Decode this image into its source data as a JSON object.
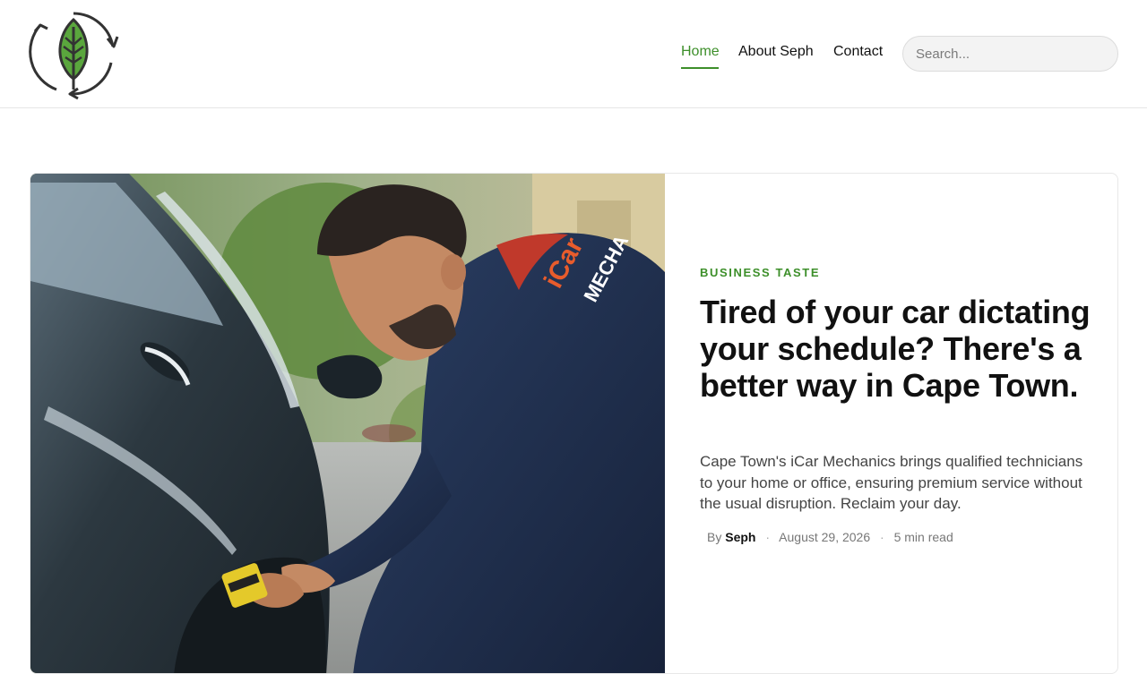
{
  "header": {
    "logo_icon": "leaf-recycle-logo-icon",
    "nav": [
      {
        "label": "Home",
        "active": true
      },
      {
        "label": "About Seph",
        "active": false
      },
      {
        "label": "Contact",
        "active": false
      }
    ],
    "search": {
      "placeholder": "Search...",
      "value": ""
    }
  },
  "featured_post": {
    "image_icon": "mechanic-hero-image",
    "category": "BUSINESS TASTE",
    "title": "Tired of your car dictating your schedule? There's a better way in Cape Town.",
    "excerpt": "Cape Town's iCar Mechanics brings qualified technicians to your home or office, ensuring premium service without the usual disruption. Reclaim your day.",
    "meta": {
      "by_label": "By",
      "author": "Seph",
      "date": "August 29, 2026",
      "read_time": "5 min read"
    },
    "shirt_text_1": "iCar",
    "shirt_text_2": "MECHA"
  },
  "colors": {
    "accent": "#3d8f2a",
    "text": "#111111",
    "muted": "#777777"
  }
}
